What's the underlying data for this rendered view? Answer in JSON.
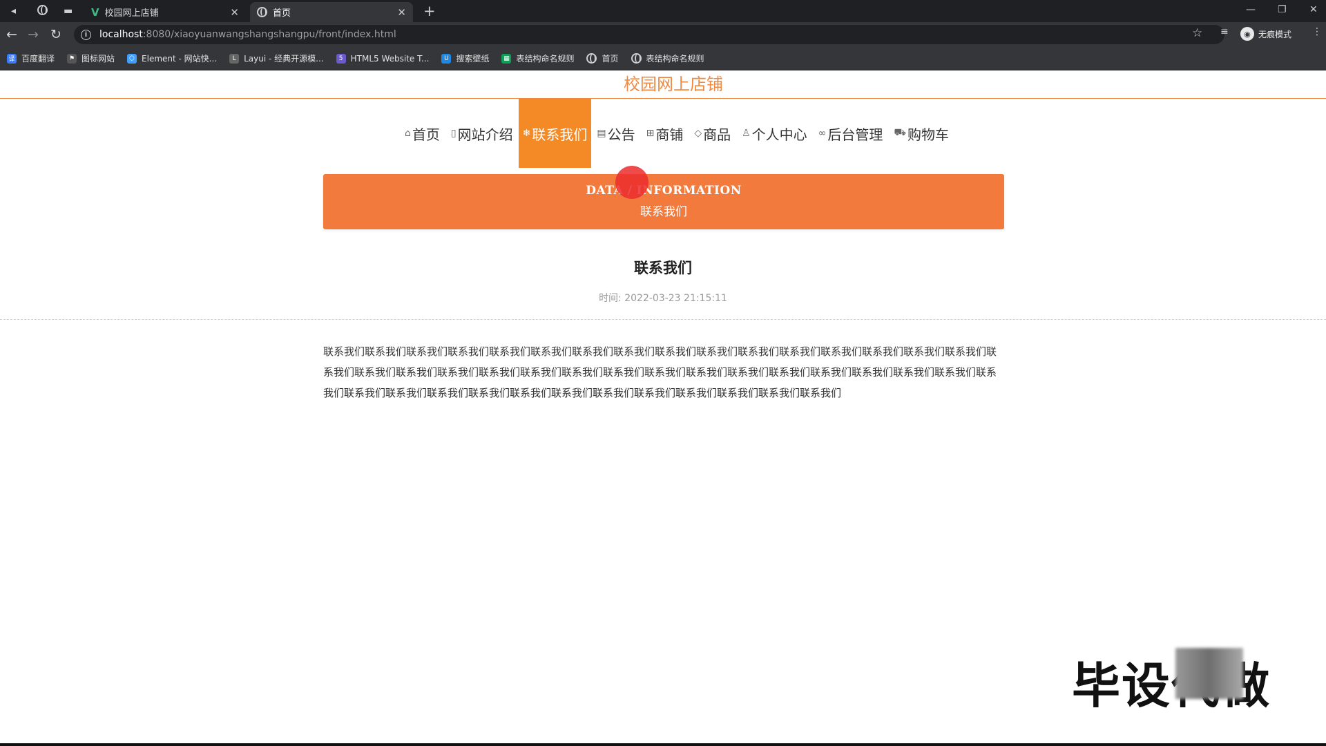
{
  "browser": {
    "tabs": [
      {
        "title": "校园网上店铺",
        "active": false
      },
      {
        "title": "首页",
        "active": true
      }
    ],
    "url_host": "localhost",
    "url_rest": ":8080/xiaoyuanwangshangshangpu/front/index.html",
    "profile_label": "无痕模式",
    "bookmarks": [
      {
        "label": "百度翻译",
        "icon": "translate-icon",
        "color": "#3a7bfd"
      },
      {
        "label": "图标网站",
        "icon": "flag-icon",
        "color": "#555555"
      },
      {
        "label": "Element - 网站快...",
        "icon": "element-icon",
        "color": "#409eff"
      },
      {
        "label": "Layui - 经典开源模...",
        "icon": "layui-icon",
        "color": "#666666"
      },
      {
        "label": "HTML5 Website T...",
        "icon": "html5-icon",
        "color": "#6a5acd"
      },
      {
        "label": "搜索壁纸",
        "icon": "wallpaper-icon",
        "color": "#1e88e5"
      },
      {
        "label": "表结构命名规则",
        "icon": "sheet-icon",
        "color": "#0f9d58"
      },
      {
        "label": "首页",
        "icon": "globe-icon",
        "color": "#888888"
      },
      {
        "label": "表结构命名规则",
        "icon": "globe-icon",
        "color": "#888888"
      }
    ]
  },
  "site": {
    "title": "校园网上店铺",
    "nav": [
      {
        "label": "首页",
        "icon": "home-icon",
        "glyph": "⌂",
        "active": false
      },
      {
        "label": "网站介绍",
        "icon": "book-icon",
        "glyph": "▯",
        "active": false
      },
      {
        "label": "联系我们",
        "icon": "contact-icon",
        "glyph": "❄",
        "active": true
      },
      {
        "label": "公告",
        "icon": "notice-icon",
        "glyph": "▤",
        "active": false
      },
      {
        "label": "商铺",
        "icon": "shop-icon",
        "glyph": "⊞",
        "active": false
      },
      {
        "label": "商品",
        "icon": "tag-icon",
        "glyph": "◇",
        "active": false
      },
      {
        "label": "个人中心",
        "icon": "user-icon",
        "glyph": "♙",
        "active": false
      },
      {
        "label": "后台管理",
        "icon": "link-icon",
        "glyph": "∞",
        "active": false
      },
      {
        "label": "购物车",
        "icon": "cart-icon",
        "glyph": "⛟",
        "active": false
      }
    ],
    "accent": "#f08a43",
    "active_nav_color": "#f48a26"
  },
  "banner": {
    "en": "DATA / INFORMATION",
    "cn": "联系我们",
    "color": "#f37a3d"
  },
  "article": {
    "title": "联系我们",
    "time": "时间:  2022-03-23 21:15:11",
    "body": "联系我们联系我们联系我们联系我们联系我们联系我们联系我们联系我们联系我们联系我们联系我们联系我们联系我们联系我们联系我们联系我们联系我们联系我们联系我们联系我们联系我们联系我们联系我们联系我们联系我们联系我们联系我们联系我们联系我们联系我们联系我们联系我们联系我们联系我们联系我们联系我们联系我们联系我们联系我们联系我们联系我们联系我们联系我们联系我们联系我们"
  },
  "watermark": "毕设代做"
}
